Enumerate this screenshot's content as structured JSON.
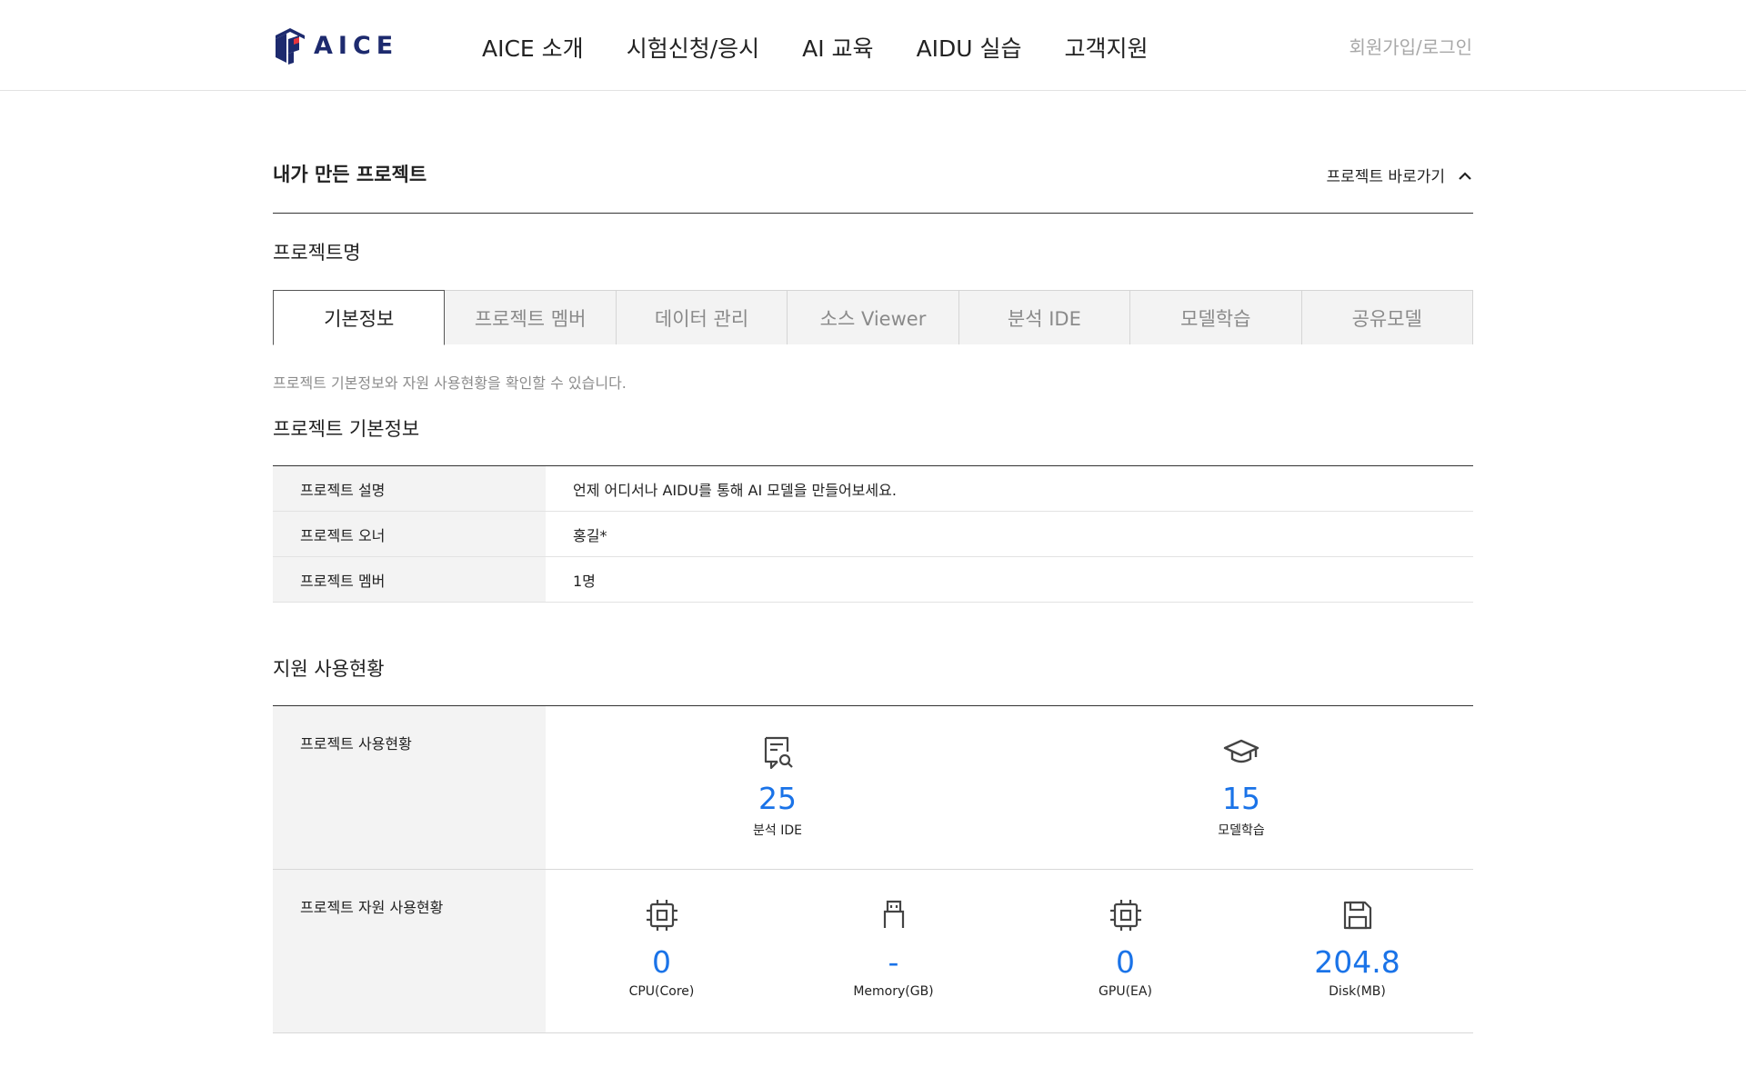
{
  "header": {
    "logo_text": "AICE",
    "nav": [
      "AICE 소개",
      "시험신청/응시",
      "AI 교육",
      "AIDU 실습",
      "고객지원"
    ],
    "login": "회원가입/로그인"
  },
  "section": {
    "title": "내가 만든 프로젝트",
    "shortcut": "프로젝트 바로가기"
  },
  "project": {
    "name": "프로젝트명",
    "tabs": [
      "기본정보",
      "프로젝트 멤버",
      "데이터 관리",
      "소스 Viewer",
      "분석 IDE",
      "모델학습",
      "공유모델"
    ],
    "active_tab": "기본정보",
    "description": "프로젝트 기본정보와 자원 사용현황을 확인할 수 있습니다."
  },
  "basic_info": {
    "title": "프로젝트 기본정보",
    "rows": [
      {
        "key": "프로젝트 설명",
        "value": "언제 어디서나 AIDU를 통해 AI 모델을 만들어보세요."
      },
      {
        "key": "프로젝트 오너",
        "value": "홍길*"
      },
      {
        "key": "프로젝트 멤버",
        "value": "1명"
      }
    ]
  },
  "usage": {
    "title": "지원 사용현황",
    "project_usage": {
      "key": "프로젝트 사용현황",
      "items": [
        {
          "icon": "document-search-icon",
          "value": "25",
          "label": "분석 IDE"
        },
        {
          "icon": "graduation-cap-icon",
          "value": "15",
          "label": "모델학습"
        }
      ]
    },
    "resource_usage": {
      "key": "프로젝트 자원 사용현황",
      "items": [
        {
          "icon": "cpu-chip-icon",
          "value": "0",
          "label": "CPU(Core)"
        },
        {
          "icon": "memory-icon",
          "value": "-",
          "label": "Memory(GB)"
        },
        {
          "icon": "gpu-chip-icon",
          "value": "0",
          "label": "GPU(EA)"
        },
        {
          "icon": "disk-save-icon",
          "value": "204.8",
          "label": "Disk(MB)"
        }
      ]
    }
  },
  "colors": {
    "accent_blue": "#1a73e8",
    "logo_navy": "#1d2a6e",
    "logo_red": "#e8343c"
  }
}
